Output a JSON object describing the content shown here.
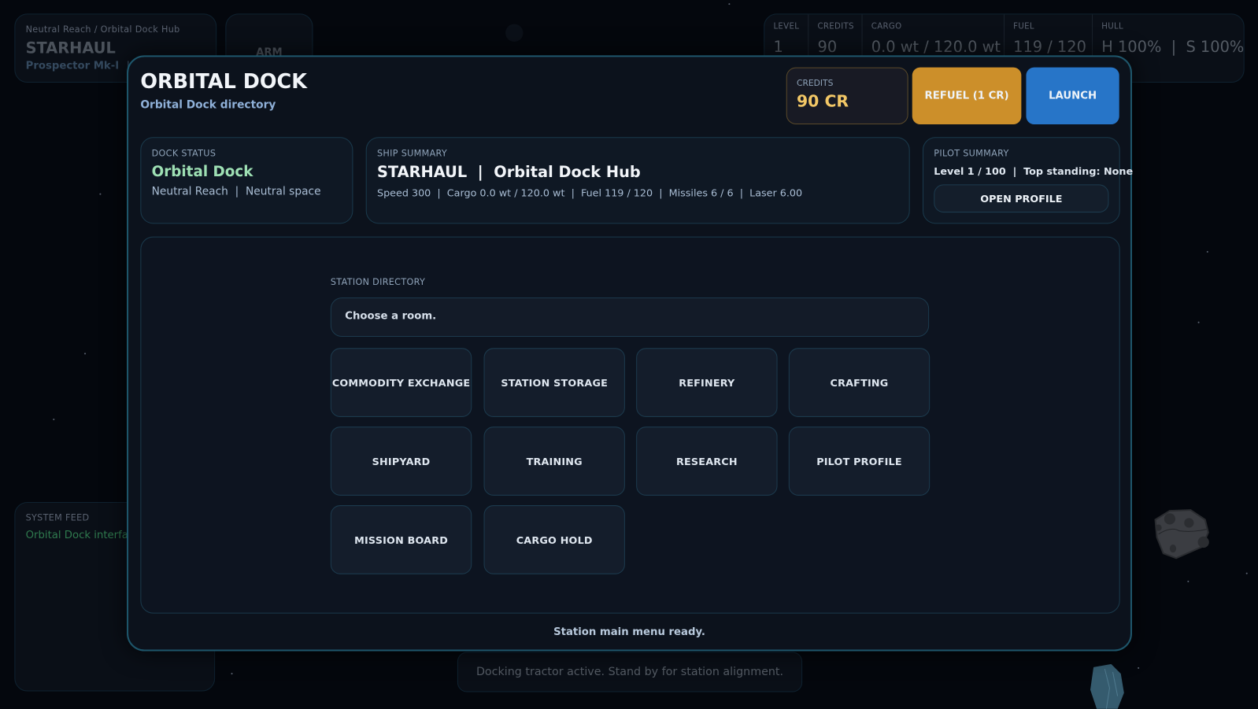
{
  "hud": {
    "location_path": "Neutral Reach / Orbital Dock Hub",
    "ship_name": "STARHAUL",
    "ship_model_line": "Prospector Mk-I  |  O",
    "arm_label": "ARM",
    "stats": [
      {
        "label": "LEVEL",
        "value": "1"
      },
      {
        "label": "CREDITS",
        "value": "90"
      },
      {
        "label": "CARGO",
        "value": "0.0 wt / 120.0 wt"
      },
      {
        "label": "FUEL",
        "value": "119 / 120"
      },
      {
        "label": "HULL",
        "value": "H 100%  |  S 100%"
      }
    ],
    "system_feed": {
      "label": "SYSTEM FEED",
      "message": "Orbital Dock interface"
    },
    "toast": "Docking tractor active. Stand by for station alignment."
  },
  "modal": {
    "title": "ORBITAL DOCK",
    "subtitle": "Orbital Dock directory",
    "credits": {
      "label": "CREDITS",
      "value": "90 CR"
    },
    "refuel_label": "REFUEL (1 CR)",
    "launch_label": "LAUNCH",
    "dock_status": {
      "label": "DOCK STATUS",
      "name": "Orbital Dock",
      "detail": "Neutral Reach  |  Neutral space"
    },
    "ship_summary": {
      "label": "SHIP SUMMARY",
      "title": "STARHAUL  |  Orbital Dock Hub",
      "detail": "Speed 300  |  Cargo 0.0 wt / 120.0 wt  |  Fuel 119 / 120  |  Missiles 6 / 6  |  Laser 6.00"
    },
    "pilot_summary": {
      "label": "PILOT SUMMARY",
      "detail": "Level 1 / 100  |  Top standing: None",
      "button": "OPEN PROFILE"
    },
    "directory": {
      "label": "STATION DIRECTORY",
      "prompt": "Choose a room.",
      "rooms": [
        "COMMODITY EXCHANGE",
        "STATION STORAGE",
        "REFINERY",
        "CRAFTING",
        "SHIPYARD",
        "TRAINING",
        "RESEARCH",
        "PILOT PROFILE",
        "MISSION BOARD",
        "CARGO HOLD"
      ]
    },
    "status": "Station main menu ready."
  },
  "colors": {
    "accent_border": "#1e566b",
    "refuel": "#cc8f2a",
    "launch": "#2775c8",
    "credits_value": "#f2c766",
    "dock_name": "#9ee0b4",
    "feed_text": "#2f7a4e"
  }
}
